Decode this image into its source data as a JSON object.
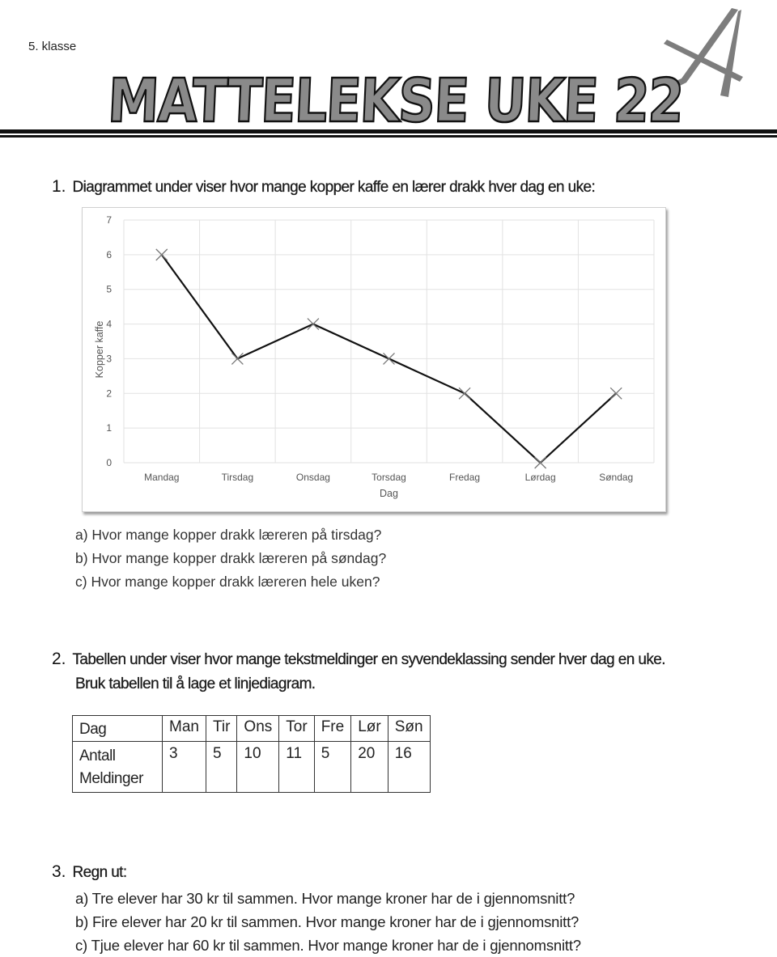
{
  "header": {
    "grade": "5. klasse",
    "title": "MATTELEKSE UKE 22",
    "level_badge": "A"
  },
  "question1": {
    "number": "1.",
    "text": "Diagrammet under viser hvor mange kopper kaffe en lærer drakk hver dag en uke:",
    "subquestions": [
      "a) Hvor mange kopper drakk læreren på tirsdag?",
      "b) Hvor mange kopper drakk læreren på søndag?",
      "c) Hvor mange kopper drakk læreren hele uken?"
    ]
  },
  "chart_data": {
    "type": "line",
    "title": "",
    "xlabel": "Dag",
    "ylabel": "Kopper kaffe",
    "categories": [
      "Mandag",
      "Tirsdag",
      "Onsdag",
      "Torsdag",
      "Fredag",
      "Lørdag",
      "Søndag"
    ],
    "series": [
      {
        "name": "Kopper kaffe",
        "values": [
          6,
          3,
          4,
          3,
          2,
          0,
          2
        ],
        "marker": "x",
        "color": "#111111"
      }
    ],
    "ylim": [
      0,
      7
    ],
    "yticks": [
      0,
      1,
      2,
      3,
      4,
      5,
      6,
      7
    ],
    "grid": true,
    "legend": "none"
  },
  "question2": {
    "number": "2.",
    "line1": "Tabellen under viser hvor mange tekstmeldinger en syvendeklassing sender hver dag en uke.",
    "line2": "Bruk tabellen til å lage et linjediagram.",
    "table": {
      "header_label": "Dag",
      "row_label": "Antall Meldinger",
      "row_label_line1": "Antall",
      "row_label_line2": "Meldinger",
      "days": [
        "Man",
        "Tir",
        "Ons",
        "Tor",
        "Fre",
        "Lør",
        "Søn"
      ],
      "values": [
        "3",
        "5",
        "10",
        "11",
        "5",
        "20",
        "16"
      ]
    }
  },
  "question3": {
    "number": "3.",
    "text": "Regn ut:",
    "subquestions": [
      "a) Tre elever har 30 kr til sammen. Hvor mange kroner har de i gjennomsnitt?",
      "b) Fire elever har 20 kr til sammen. Hvor mange kroner har de i gjennomsnitt?",
      "c) Tjue elever har 60 kr til sammen. Hvor mange kroner har de i gjennomsnitt?"
    ]
  }
}
